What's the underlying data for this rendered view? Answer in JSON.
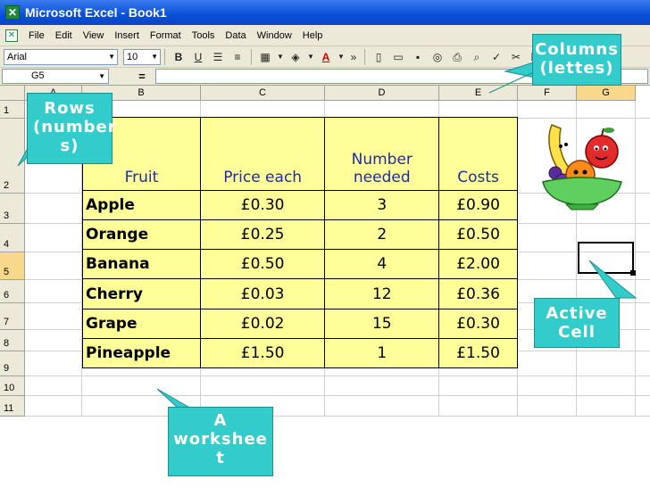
{
  "window": {
    "title": "Microsoft Excel - Book1"
  },
  "menu": [
    "File",
    "Edit",
    "View",
    "Insert",
    "Format",
    "Tools",
    "Data",
    "Window",
    "Help"
  ],
  "toolbar": {
    "font_name": "Arial",
    "font_size": "10",
    "bold_label": "B",
    "underline_label": "U",
    "font_color_label": "A",
    "overflow_label": "»"
  },
  "formula_bar": {
    "name_box": "G5",
    "eq_symbol": "=",
    "formula": ""
  },
  "sheet": {
    "columns": [
      "A",
      "B",
      "C",
      "D",
      "E",
      "F",
      "G"
    ],
    "rows": [
      "1",
      "2",
      "3",
      "4",
      "5",
      "6",
      "7",
      "8",
      "9",
      "10",
      "11"
    ],
    "active_cell": "G5"
  },
  "table": {
    "headers": [
      "Fruit",
      "Price each",
      "Number needed",
      "Costs"
    ],
    "rows": [
      [
        "Apple",
        "£0.30",
        "3",
        "£0.90"
      ],
      [
        "Orange",
        "£0.25",
        "2",
        "£0.50"
      ],
      [
        "Banana",
        "£0.50",
        "4",
        "£2.00"
      ],
      [
        "Cherry",
        "£0.03",
        "12",
        "£0.36"
      ],
      [
        "Grape",
        "£0.02",
        "15",
        "£0.30"
      ],
      [
        "Pineapple",
        "£1.50",
        "1",
        "£1.50"
      ]
    ]
  },
  "callouts": {
    "columns": "Columns (lettes)",
    "rows": "Rows (number s)",
    "active_cell": "Active Cell",
    "worksheet": "A workshee t"
  },
  "colors": {
    "callout_fill": "#33cccc",
    "table_fill": "#ffff99",
    "header_text": "#1d2ba6",
    "titlebar": "#0a4fd8"
  },
  "icons": [
    "excel-app-icon",
    "fruit-bowl-clipart"
  ]
}
